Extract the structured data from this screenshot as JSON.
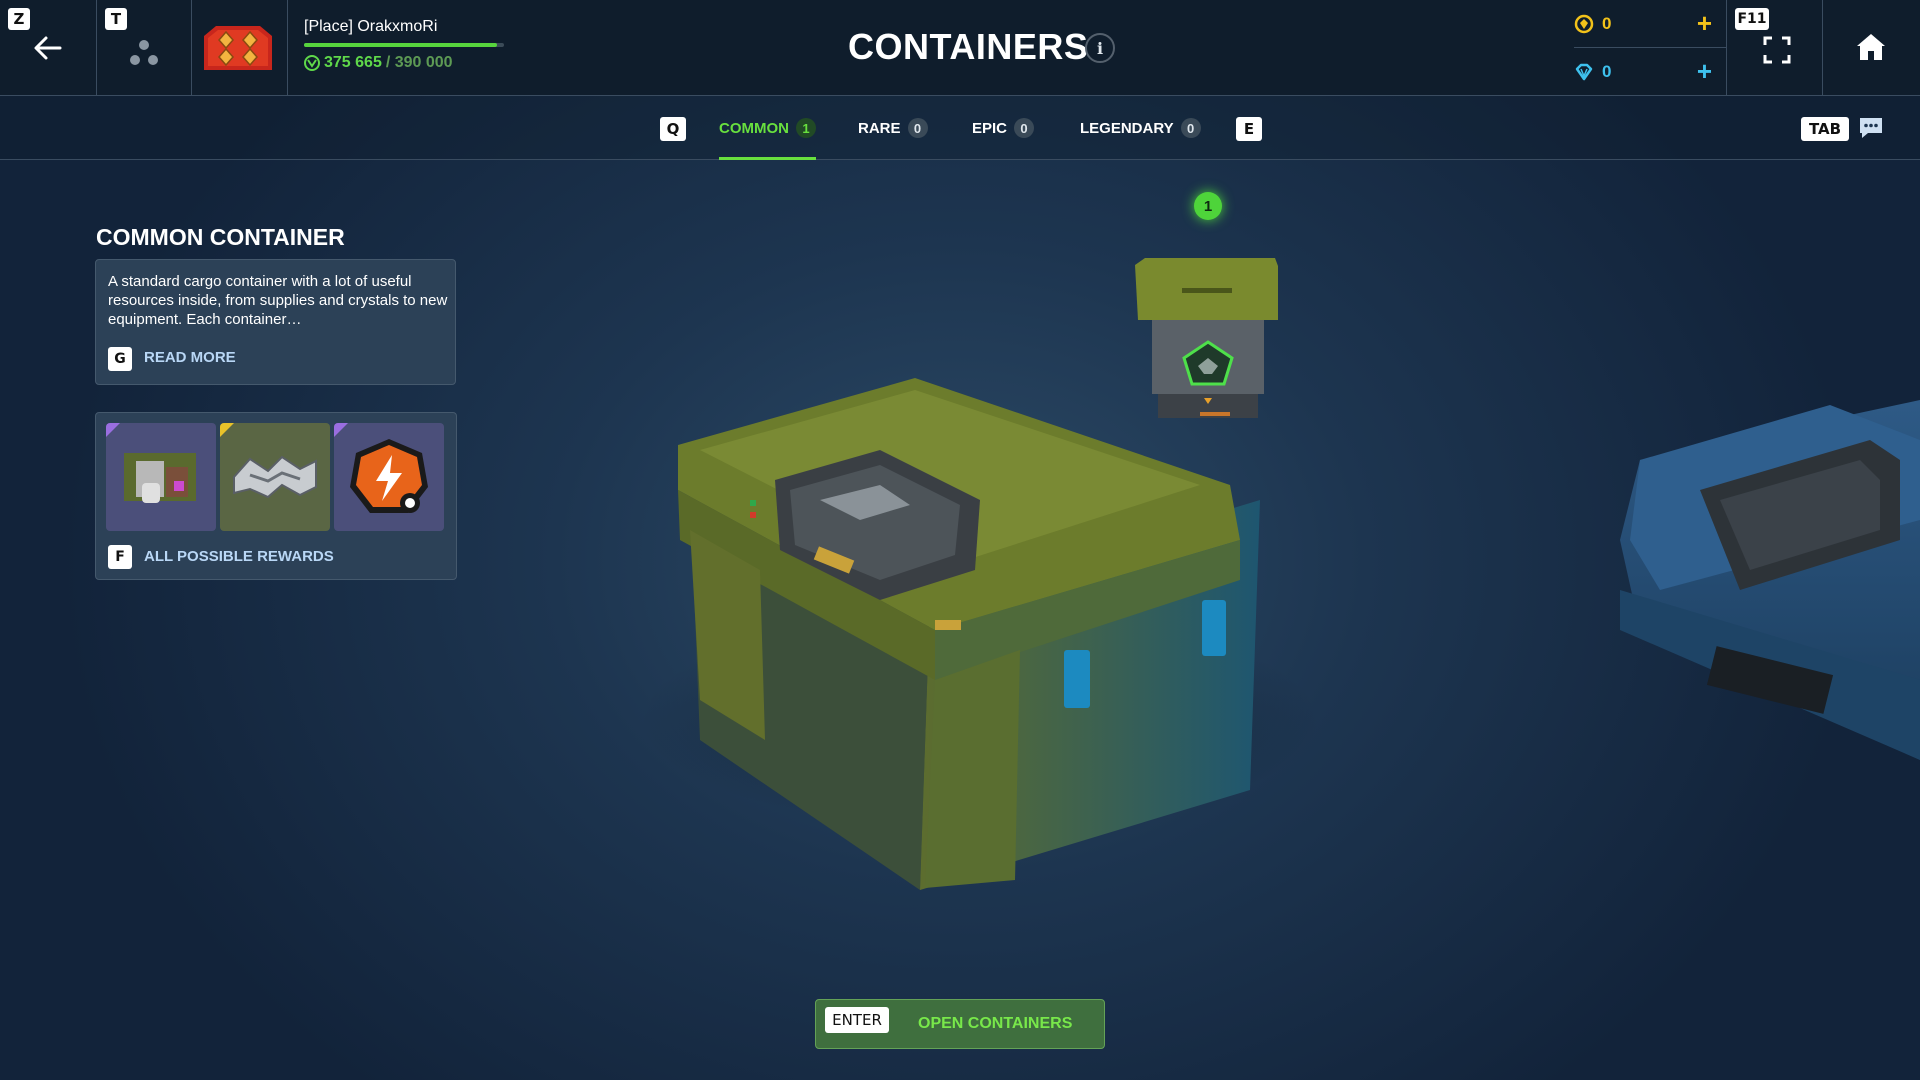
{
  "header": {
    "back_key": "Z",
    "friends_key": "T",
    "player_name": "[Place] OrakxmoRi",
    "xp_current": "375 665",
    "xp_total": "/ 390 000",
    "xp_progress": 0.963,
    "page_title": "CONTAINERS",
    "info_glyph": "i",
    "gold_value": "0",
    "gem_value": "0",
    "plus_glyph": "+",
    "fullscreen_key": "F11"
  },
  "tabs": {
    "prev_key": "Q",
    "next_key": "E",
    "items": [
      {
        "label": "COMMON",
        "count": "1",
        "active": true
      },
      {
        "label": "RARE",
        "count": "0",
        "active": false
      },
      {
        "label": "EPIC",
        "count": "0",
        "active": false
      },
      {
        "label": "LEGENDARY",
        "count": "0",
        "active": false
      }
    ],
    "chat_key": "TAB"
  },
  "container": {
    "title": "COMMON CONTAINER",
    "description": "A standard cargo container with a lot of useful resources inside, from supplies and crystals to new equipment. Each container…",
    "read_more_key": "G",
    "read_more_label": "READ MORE",
    "rewards_key": "F",
    "rewards_label": "ALL POSSIBLE REWARDS",
    "count_badge": "1"
  },
  "footer": {
    "enter_key": "ENTER",
    "open_label": "OPEN CONTAINERS"
  },
  "icons": [
    "back-arrow-icon",
    "friends-icon",
    "rank-icon",
    "info-icon",
    "crystal-coin-icon",
    "gem-icon",
    "fullscreen-icon",
    "home-icon",
    "chat-icon"
  ],
  "colors": {
    "accent_green": "#68e03e",
    "gold": "#f2c21a",
    "gem_blue": "#3ec1ee",
    "panel": "#2c4157",
    "topbar": "#0f1d2c"
  }
}
